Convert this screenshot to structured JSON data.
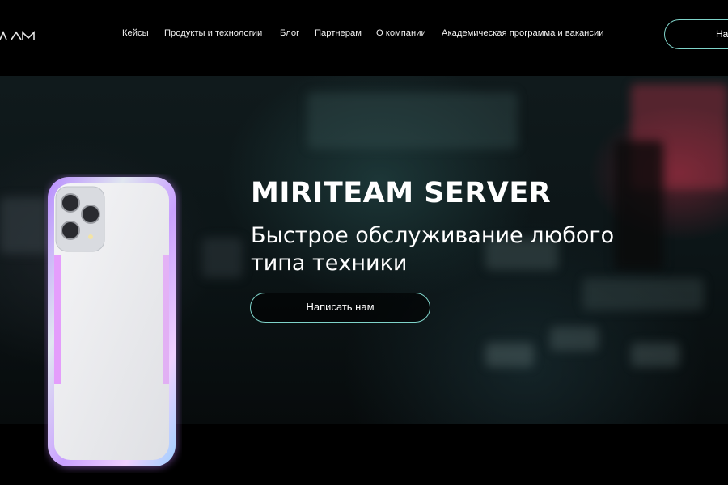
{
  "header": {
    "logo_text": "AM",
    "nav": [
      {
        "label": "Кейсы"
      },
      {
        "label": "Продукты и технологии"
      },
      {
        "label": "Блог"
      },
      {
        "label": "Партнерам"
      },
      {
        "label": "О компании"
      },
      {
        "label": "Академическая программа и вакансии"
      }
    ],
    "cta_label": "На"
  },
  "hero": {
    "title": "MIRITEAM SERVER",
    "subtitle": "Быстрое обслуживание любого типа техники",
    "cta_label": "Написать нам"
  },
  "colors": {
    "accent_border": "#7fd3c9",
    "background": "#000000"
  }
}
